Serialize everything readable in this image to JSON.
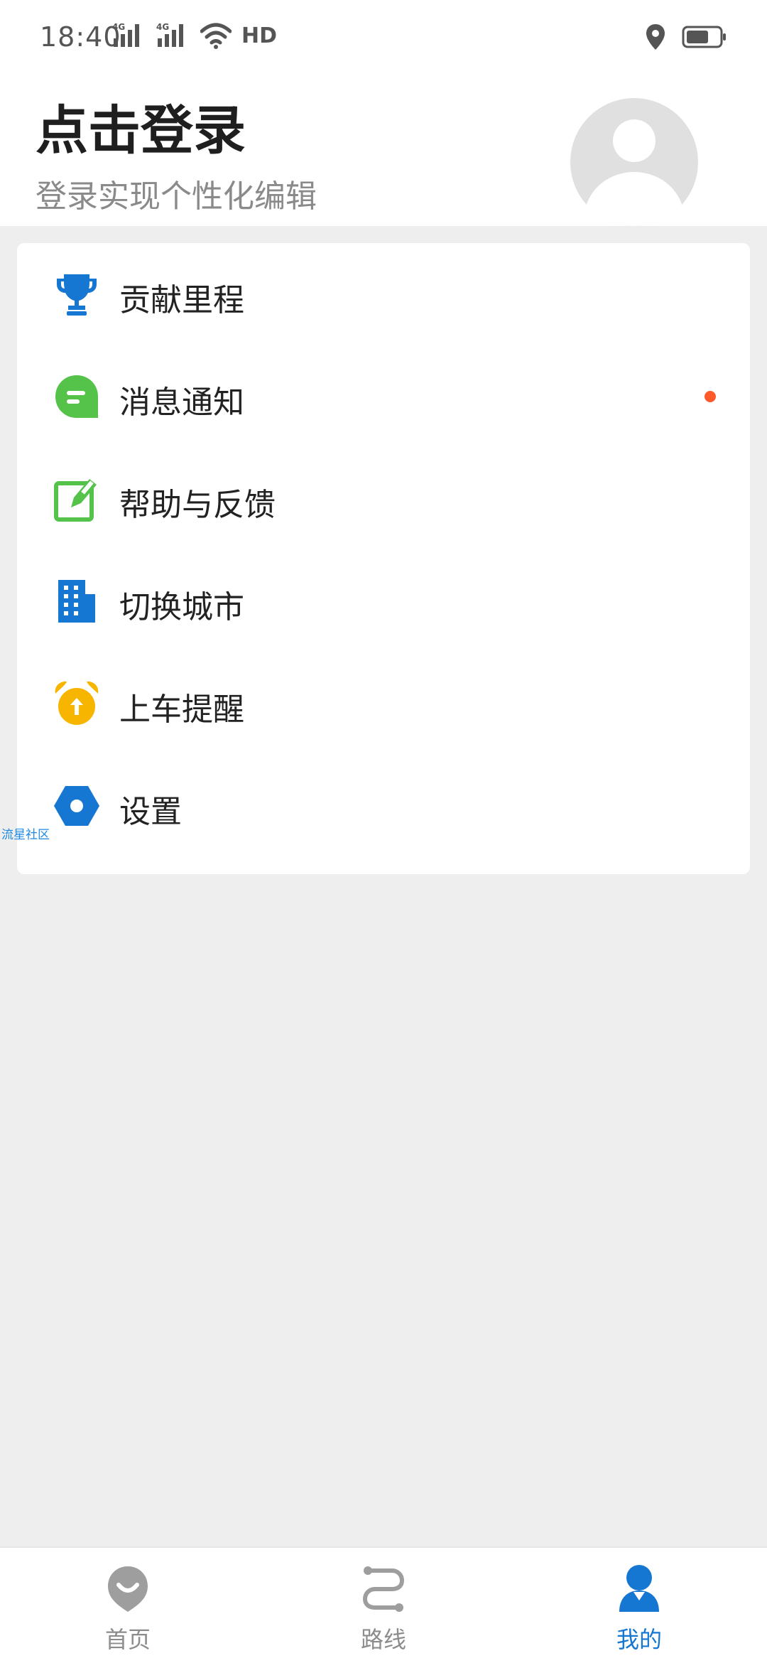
{
  "status_bar": {
    "time": "18:40",
    "network_labels": [
      "4G",
      "4G"
    ],
    "hd_label": "HD",
    "icons": [
      "signal-4g-icon",
      "signal-4g-icon",
      "wifi-icon",
      "location-icon",
      "battery-icon"
    ]
  },
  "header": {
    "title": "点击登录",
    "subtitle": "登录实现个性化编辑",
    "avatar_icon": "user-avatar-icon"
  },
  "menu": {
    "items": [
      {
        "label": "贡献里程",
        "icon": "trophy-icon",
        "color": "#1677d2"
      },
      {
        "label": "消息通知",
        "icon": "message-icon",
        "color": "#55c24a",
        "badge": "dot"
      },
      {
        "label": "帮助与反馈",
        "icon": "edit-feedback-icon",
        "color": "#55c24a"
      },
      {
        "label": "切换城市",
        "icon": "building-icon",
        "color": "#1677d2"
      },
      {
        "label": "上车提醒",
        "icon": "alarm-clock-icon",
        "color": "#f7b500"
      },
      {
        "label": "设置",
        "icon": "settings-hex-icon",
        "color": "#1677d2"
      }
    ]
  },
  "watermark": "流星社区",
  "bottom_nav": {
    "tabs": [
      {
        "label": "首页",
        "icon": "home-face-icon",
        "active": false
      },
      {
        "label": "路线",
        "icon": "route-icon",
        "active": false
      },
      {
        "label": "我的",
        "icon": "profile-icon",
        "active": true
      }
    ]
  },
  "colors": {
    "accent": "#1677d2",
    "green": "#55c24a",
    "orange": "#f7b500",
    "badge_red": "#ff5a2c",
    "background": "#eeeeee"
  }
}
